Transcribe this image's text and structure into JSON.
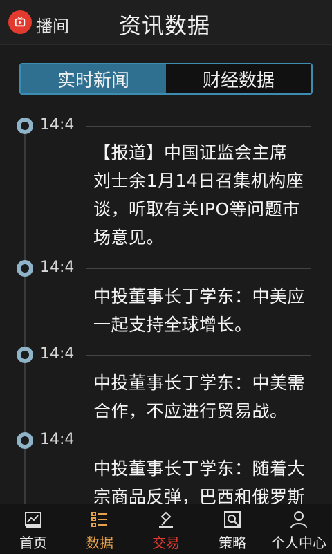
{
  "header": {
    "app_name": "播间",
    "title": "资讯数据",
    "logo_icon": "tv-icon",
    "brand_color": "#e23a2e"
  },
  "tabs": [
    {
      "label": "实时新闻",
      "active": true
    },
    {
      "label": "财经数据",
      "active": false
    }
  ],
  "news": [
    {
      "time": "14:4",
      "lines": [
        "【报道】中国证监会主席",
        "刘士余1月14日召集机构座",
        "谈，听取有关IPO等问题市",
        "场意见。"
      ]
    },
    {
      "time": "14:4",
      "lines": [
        "中投董事长丁学东：中美应",
        "一起支持全球增长。"
      ]
    },
    {
      "time": "14:4",
      "lines": [
        "中投董事长丁学东：中美需",
        "合作，不应进行贸易战。"
      ]
    },
    {
      "time": "14:4",
      "lines": [
        "中投董事长丁学东：随着大",
        "宗商品反弹，巴西和俄罗斯"
      ]
    }
  ],
  "nav": [
    {
      "label": "首页",
      "icon": "chart-icon"
    },
    {
      "label": "数据",
      "icon": "list-icon"
    },
    {
      "label": "交易",
      "icon": "gavel-icon"
    },
    {
      "label": "策略",
      "icon": "strategy-icon"
    },
    {
      "label": "个人中心",
      "icon": "user-icon"
    }
  ]
}
